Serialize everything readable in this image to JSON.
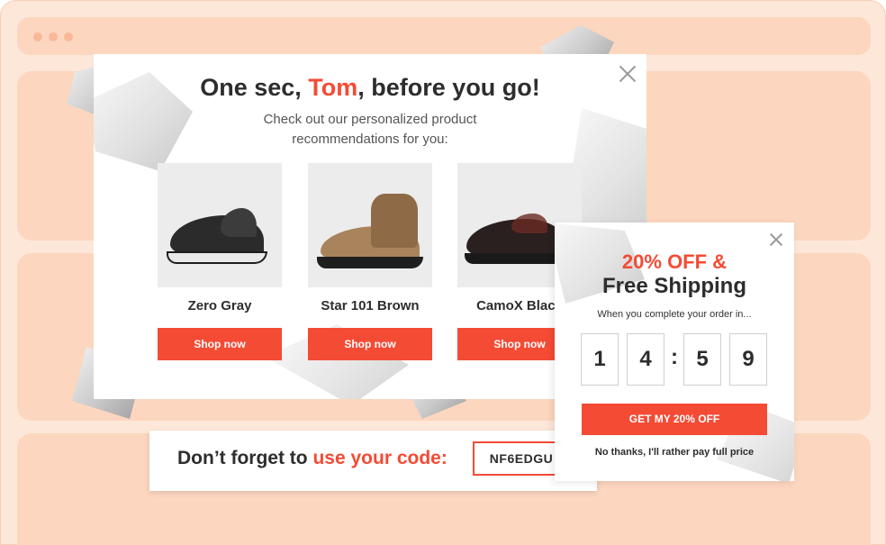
{
  "browser": {
    "window_controls": [
      "dot",
      "dot",
      "dot"
    ]
  },
  "main_popup": {
    "title_prefix": "One sec, ",
    "title_name": "Tom",
    "title_suffix": ", before you go!",
    "subtitle": "Check out our personalized product recommendations for you:",
    "close_icon": "close-icon",
    "products": [
      {
        "name": "Zero Gray",
        "button": "Shop now"
      },
      {
        "name": "Star 101 Brown",
        "button": "Shop now"
      },
      {
        "name": "CamoX Black",
        "button": "Shop now"
      }
    ]
  },
  "code_bar": {
    "message_prefix": "Don’t forget to ",
    "message_accent": "use your code:",
    "code": "NF6EDGU"
  },
  "discount_popup": {
    "headline_1": "20% OFF &",
    "headline_2": "Free Shipping",
    "subtext": "When you complete your order in...",
    "countdown": [
      "1",
      "4",
      "5",
      "9"
    ],
    "separator": ":",
    "cta": "GET MY 20% OFF",
    "decline": "No thanks, I'll rather pay full price"
  },
  "colors": {
    "accent": "#f44b35",
    "background": "#fde7d8",
    "panel": "#fcd6bf"
  }
}
